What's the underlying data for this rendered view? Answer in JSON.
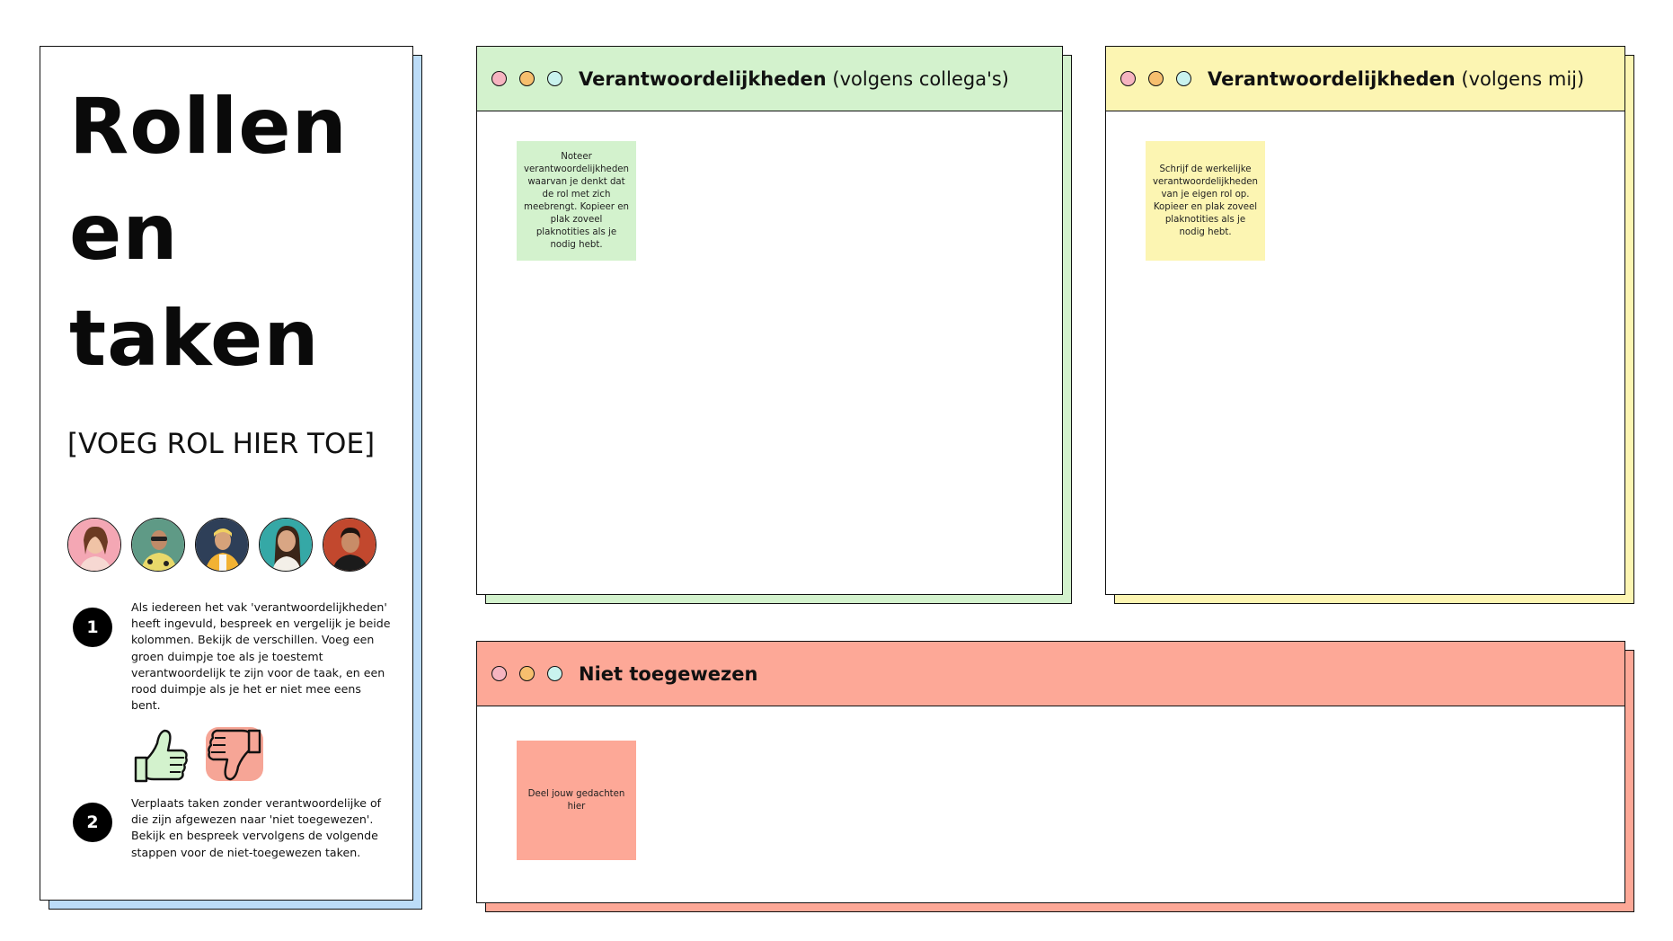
{
  "left_panel": {
    "title_lines": [
      "Rollen",
      "en",
      "taken"
    ],
    "role_placeholder": "[VOEG ROL HIER TOE]",
    "avatars": [
      "avatar-1",
      "avatar-2",
      "avatar-3",
      "avatar-4",
      "avatar-5"
    ],
    "steps": [
      {
        "number": "1",
        "text": "Als iedereen het vak 'verantwoordelijkheden' heeft ingevuld, bespreek en vergelijk je beide kolommen. Bekijk de verschillen. Voeg een groen duimpje toe als je toestemt verantwoordelijk te zijn voor de taak, en een rood duimpje als je het er niet mee eens bent."
      },
      {
        "number": "2",
        "text": "Verplaats taken zonder verantwoordelijke of die zijn afgewezen naar 'niet toegewezen'. Bekijk en bespreek vervolgens de volgende stappen voor de niet-toegewezen taken."
      }
    ],
    "thumbs": [
      "thumbs-up-icon",
      "thumbs-down-icon"
    ]
  },
  "boards": {
    "colleagues": {
      "title_bold": "Verantwoordelijkheden",
      "title_rest": " (volgens collega's)",
      "sticky_text": "Noteer verantwoordelijkheden waarvan je denkt dat de rol met zich meebrengt. Kopieer en plak zoveel plaknotities als je nodig hebt."
    },
    "mine": {
      "title_bold": "Verantwoordelijkheden",
      "title_rest": " (volgens mij)",
      "sticky_text": "Schrijf de werkelijke verantwoordelijkheden van je eigen rol op. Kopieer en plak zoveel plaknotities als je nodig hebt."
    },
    "unassigned": {
      "title_bold": "Niet toegewezen",
      "sticky_text": "Deel jouw gedachten hier"
    }
  },
  "colors": {
    "green_header": "#d3f2cd",
    "yellow_header": "#fcf5b2",
    "red_header": "#fda897",
    "blue_shadow": "#bcdcf8",
    "green_sticky": "#d3f2cd",
    "yellow_sticky": "#fcf5b2",
    "red_sticky": "#fda897"
  }
}
